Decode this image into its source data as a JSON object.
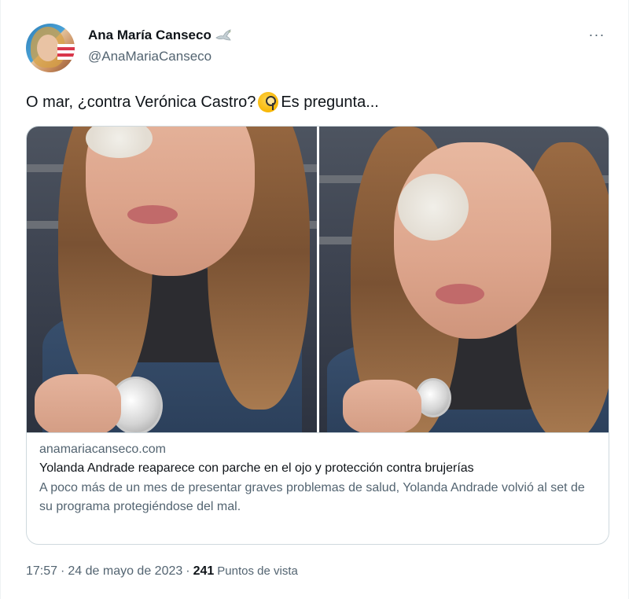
{
  "author": {
    "display_name": "Ana María Canseco",
    "handle": "@AnaMariaCanseco",
    "badge_icon": "dove-icon"
  },
  "tweet": {
    "text_before_emoji": "O mar, ¿contra Verónica Castro?",
    "emoji_icon": "face-with-monocle-icon",
    "text_after_emoji": "Es pregunta..."
  },
  "card": {
    "domain": "anamariacanseco.com",
    "title": "Yolanda Andrade reaparece con parche en el ojo y protección contra brujerías",
    "description": "A poco más de un mes de presentar graves problemas de salud, Yolanda Andrade volvió al set de su programa protegiéndose del mal."
  },
  "meta": {
    "time": "17:57",
    "separator": "·",
    "date": "24 de mayo de 2023",
    "views_count": "241",
    "views_label": "Puntos de vista"
  },
  "more_menu": "···",
  "colors": {
    "text_primary": "#0f1419",
    "text_secondary": "#536471",
    "border": "#cfd9de"
  }
}
